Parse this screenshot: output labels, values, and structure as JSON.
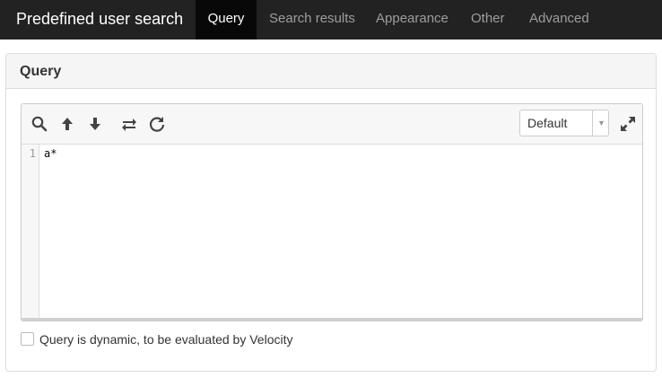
{
  "navbar": {
    "brand": "Predefined user search",
    "tabs": [
      {
        "label": "Query",
        "active": true
      },
      {
        "label": "Search results",
        "active": false
      },
      {
        "label": "Appearance",
        "active": false
      },
      {
        "label": "Other",
        "active": false
      },
      {
        "label": "Advanced",
        "active": false
      }
    ]
  },
  "panel": {
    "title": "Query"
  },
  "editor": {
    "toolbar_icons": [
      "search-icon",
      "arrow-up-icon",
      "arrow-down-icon",
      "replace-icon",
      "refresh-icon"
    ],
    "mode_select": {
      "value": "Default"
    },
    "expand_icon": "expand-icon",
    "lines": [
      {
        "number": "1",
        "text": "a*"
      }
    ]
  },
  "dynamic_checkbox": {
    "label": "Query is dynamic, to be evaluated by Velocity",
    "checked": false
  },
  "colors": {
    "navbar_bg": "#222222",
    "navbar_active_bg": "#080808",
    "panel_heading_bg": "#f5f5f5"
  }
}
